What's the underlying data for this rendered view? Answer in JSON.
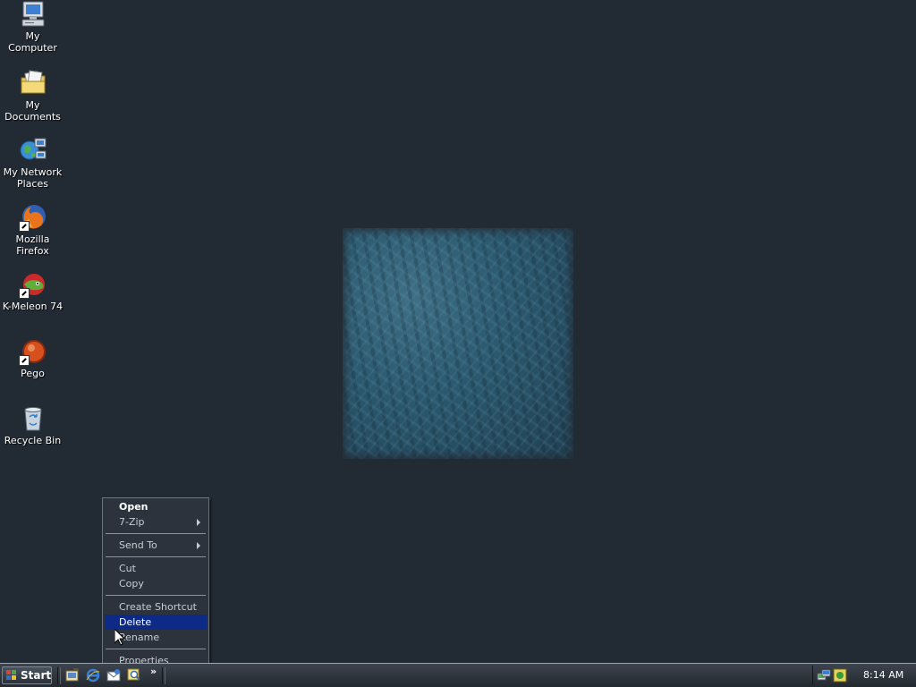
{
  "desktop": {
    "icons": [
      {
        "label": "My Computer"
      },
      {
        "label": "My Documents"
      },
      {
        "label": "My Network Places"
      },
      {
        "label": "Mozilla Firefox"
      },
      {
        "label": "K-Meleon 74"
      },
      {
        "label": "Pego"
      },
      {
        "label": "Recycle Bin"
      }
    ]
  },
  "context_menu": {
    "items": [
      {
        "label": "Open"
      },
      {
        "label": "7-Zip"
      },
      {
        "label": "Send To"
      },
      {
        "label": "Cut"
      },
      {
        "label": "Copy"
      },
      {
        "label": "Create Shortcut"
      },
      {
        "label": "Delete"
      },
      {
        "label": "Rename"
      },
      {
        "label": "Properties"
      }
    ]
  },
  "taskbar": {
    "start_label": "Start",
    "quick_launch_more": "»",
    "clock": "8:14 AM"
  }
}
